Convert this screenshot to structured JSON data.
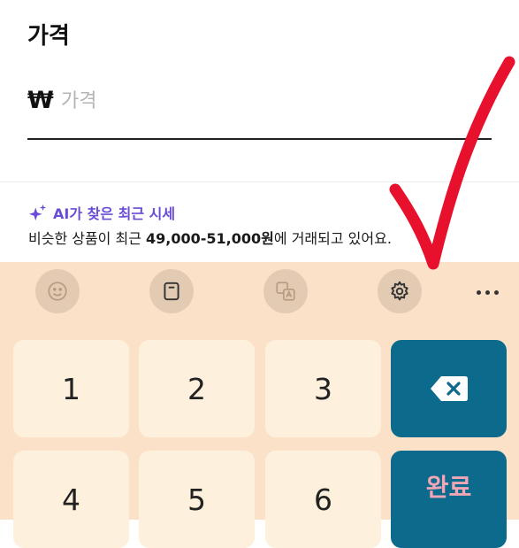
{
  "section": {
    "title": "가격"
  },
  "price": {
    "currency_symbol": "₩",
    "placeholder": "가격",
    "value": ""
  },
  "ai": {
    "title": "AI가 찾은 최근 시세",
    "desc_prefix": "비슷한 상품이 최근 ",
    "desc_range": "49,000-51,000원",
    "desc_suffix": "에 거래되고 있어요."
  },
  "keyboard": {
    "toolbar": [
      "smiley-icon",
      "clipboard-icon",
      "translate-icon",
      "gear-icon",
      "more-icon"
    ],
    "keys": [
      "1",
      "2",
      "3",
      "4",
      "5",
      "6"
    ],
    "done_label": "완료",
    "backspace_icon": "backspace-icon"
  },
  "colors": {
    "keyboard_bg": "#fae1c7",
    "key_bg": "#fdf0dc",
    "action_key": "#0c6a8c",
    "ai_accent": "#6a4cd6",
    "annotation": "#e8112d"
  }
}
